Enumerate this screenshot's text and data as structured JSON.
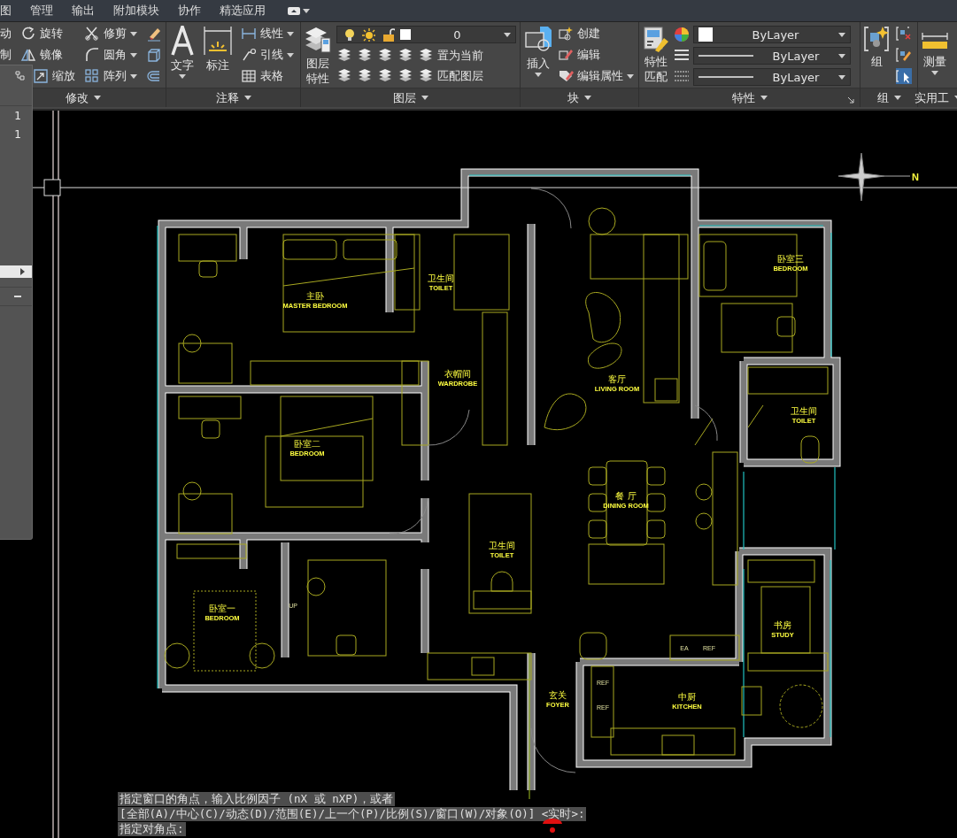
{
  "ribbon_tabs": [
    {
      "label": "图"
    },
    {
      "label": "管理"
    },
    {
      "label": "输出"
    },
    {
      "label": "附加模块"
    },
    {
      "label": "协作"
    },
    {
      "label": "精选应用"
    }
  ],
  "modify_panel": {
    "title": "修改",
    "columns": [
      [
        {
          "label": "动",
          "dropdown": false
        },
        {
          "label": "制",
          "dropdown": false
        }
      ],
      [
        {
          "label": "旋转",
          "dropdown": false
        },
        {
          "label": "镜像",
          "dropdown": false
        },
        {
          "label": "缩放",
          "dropdown": false
        }
      ],
      [
        {
          "label": "修剪",
          "dropdown": true
        },
        {
          "label": "圆角",
          "dropdown": true
        },
        {
          "label": "阵列",
          "dropdown": true
        }
      ]
    ]
  },
  "annotation_panel": {
    "title": "注释",
    "large": [
      {
        "label": "文字",
        "dropdown": true
      },
      {
        "label": "标注",
        "dropdown": false
      }
    ],
    "tools": [
      {
        "label": "线性",
        "dropdown": true
      },
      {
        "label": "引线",
        "dropdown": true
      },
      {
        "label": "表格",
        "dropdown": false
      }
    ]
  },
  "layers_panel": {
    "title": "图层",
    "large": {
      "label": "图层特性"
    },
    "layer_dropdown": {
      "value": "0"
    },
    "tools": [
      {
        "label": "置为当前"
      },
      {
        "label": "匹配图层"
      }
    ]
  },
  "block_panel": {
    "title": "块",
    "large": {
      "label": "插入",
      "dropdown": true
    },
    "tools": [
      {
        "label": "创建",
        "dropdown": false
      },
      {
        "label": "编辑",
        "dropdown": false
      },
      {
        "label": "编辑属性",
        "dropdown": true
      }
    ]
  },
  "properties_panel": {
    "title": "特性",
    "large": {
      "label": "特性匹配"
    },
    "dropdowns": [
      {
        "kind": "color",
        "value": "ByLayer"
      },
      {
        "kind": "linetype",
        "value": "ByLayer"
      },
      {
        "kind": "lineweight",
        "value": "ByLayer"
      }
    ]
  },
  "group_panel": {
    "title": "组",
    "large": {
      "label": "组"
    }
  },
  "utilities_panel": {
    "title": "实用工",
    "large": {
      "label": "测量",
      "dropdown": true
    }
  },
  "palette": {
    "rows": [
      "1",
      "1"
    ]
  },
  "drawing": {
    "rooms": [
      {
        "name": "主卧",
        "name_en": "MASTER BEDROOM"
      },
      {
        "name": "卫生间",
        "name_en": "TOILET"
      },
      {
        "name": "衣帽间",
        "name_en": "WARDROBE"
      },
      {
        "name": "客厅",
        "name_en": "LIVING ROOM"
      },
      {
        "name": "卧室三",
        "name_en": "BEDROOM"
      },
      {
        "name": "卫生间",
        "name_en": "TOILET"
      },
      {
        "name": "卧室二",
        "name_en": "BEDROOM"
      },
      {
        "name": "餐 厅",
        "name_en": "DINING ROOM"
      },
      {
        "name": "卫生间",
        "name_en": "TOILET"
      },
      {
        "name": "卧室一",
        "name_en": "BEDROOM"
      },
      {
        "name": "书房",
        "name_en": "STUDY"
      },
      {
        "name": "玄关",
        "name_en": "FOYER"
      },
      {
        "name": "中厨",
        "name_en": "KITCHEN"
      }
    ],
    "notes": [
      "UP",
      "EA",
      "REF",
      "REF",
      "REF"
    ],
    "compass": "N"
  },
  "command_line": {
    "lines": [
      "指定窗口的角点，输入比例因子 (nX 或 nXP)，或者",
      "[全部(A)/中心(C)/动态(D)/范围(E)/上一个(P)/比例(S)/窗口(W)/对象(O)] <实时>:",
      "指定对角点:"
    ]
  }
}
